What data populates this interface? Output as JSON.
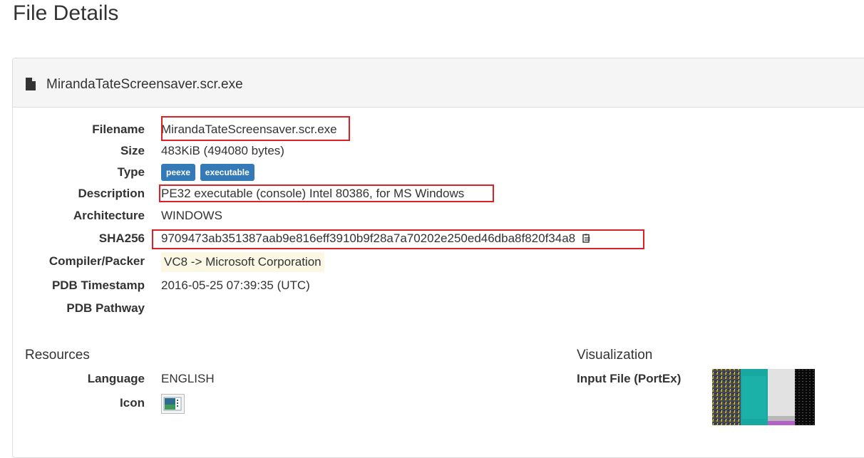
{
  "page": {
    "title": "File Details"
  },
  "header": {
    "filename": "MirandaTateScreensaver.scr.exe"
  },
  "details": {
    "filename": {
      "label": "Filename",
      "value": "MirandaTateScreensaver.scr.exe"
    },
    "size": {
      "label": "Size",
      "value": "483KiB (494080 bytes)"
    },
    "type": {
      "label": "Type",
      "tags": [
        "peexe",
        "executable"
      ]
    },
    "description": {
      "label": "Description",
      "value": "PE32 executable (console) Intel 80386, for MS Windows"
    },
    "architecture": {
      "label": "Architecture",
      "value": "WINDOWS"
    },
    "sha256": {
      "label": "SHA256",
      "value": "9709473ab351387aab9e816eff3910b9f28a7a70202e250ed46dba8f820f34a8"
    },
    "compiler": {
      "label": "Compiler/Packer",
      "value": "VC8 -> Microsoft Corporation"
    },
    "pdb_timestamp": {
      "label": "PDB Timestamp",
      "value": "2016-05-25 07:39:35 (UTC)"
    },
    "pdb_pathway": {
      "label": "PDB Pathway",
      "value": ""
    }
  },
  "resources": {
    "title": "Resources",
    "language": {
      "label": "Language",
      "value": "ENGLISH"
    },
    "icon": {
      "label": "Icon"
    }
  },
  "visualization": {
    "title": "Visualization",
    "input_file": {
      "label": "Input File (PortEx)"
    }
  },
  "colors": {
    "highlight_border": "#dd1f26",
    "badge": "#337ab7",
    "compiler_bg": "#fcf8e3",
    "panel_heading_bg": "#f5f5f5"
  },
  "icons": [
    "file-icon",
    "copy-icon"
  ]
}
